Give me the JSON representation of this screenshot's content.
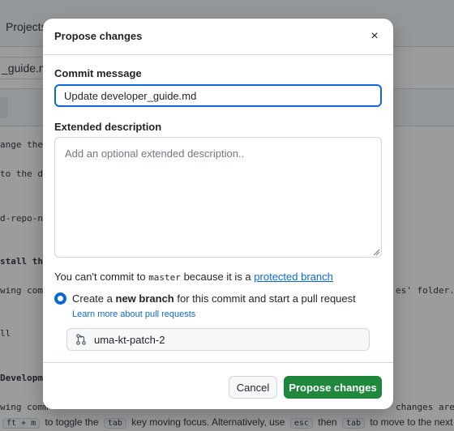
{
  "background": {
    "nav": {
      "projects_label": "Projects"
    },
    "file_name": "_guide.md",
    "editor_lines": [
      "ange the",
      "to the di",
      "d-repo-na",
      "stall the",
      "wing comm",
      "ll",
      "Developme",
      "wing comm"
    ],
    "editor_right_fragments": [
      "es' folder.",
      "changes are m"
    ],
    "footer": {
      "prefix": "ft + m",
      "text1": "to toggle the",
      "key_tab": "tab",
      "text2": "key moving focus. Alternatively, use",
      "key_esc": "esc",
      "text3": "then",
      "key_tab2": "tab",
      "text4": "to move to the next interact"
    }
  },
  "dialog": {
    "title": "Propose changes",
    "close_glyph": "×",
    "commit_message": {
      "label": "Commit message",
      "value": "Update developer_guide.md"
    },
    "extended_description": {
      "label": "Extended description",
      "placeholder": "Add an optional extended description.."
    },
    "branch_warning": {
      "prefix": "You can't commit to",
      "branch": "master",
      "middle": "because it is a",
      "link": "protected branch"
    },
    "new_branch_option": {
      "text_before": "Create a",
      "text_bold": "new branch",
      "text_after": "for this commit and start a pull request",
      "learn_more": "Learn more about pull requests",
      "selected": true
    },
    "branch_name": "uma-kt-patch-2",
    "buttons": {
      "cancel": "Cancel",
      "propose": "Propose changes"
    }
  },
  "colors": {
    "accent": "#0969da",
    "primary_button": "#1f883d",
    "border": "#d0d7de"
  },
  "icons": {
    "close": "close-icon",
    "branch": "git-pull-request-icon",
    "resize": "resize-grip-icon"
  }
}
